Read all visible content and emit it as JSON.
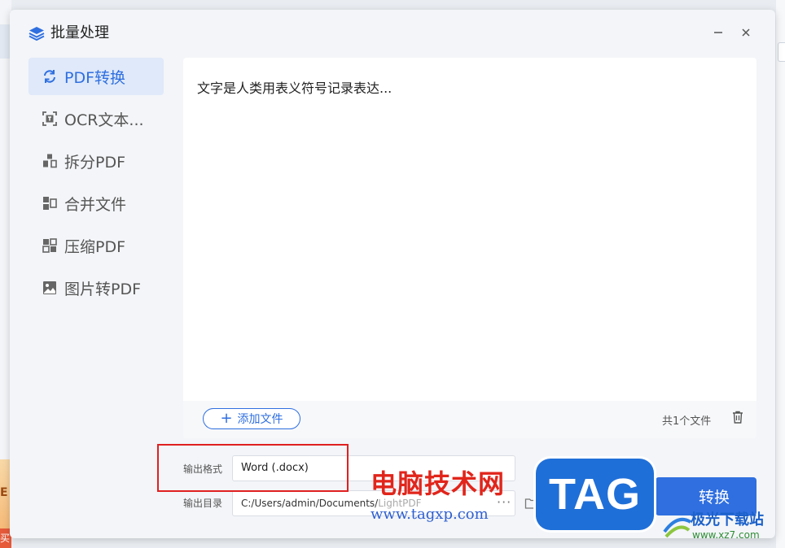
{
  "window": {
    "title": "批量处理",
    "icons": {
      "app": "layers-icon",
      "minimize": "minimize-icon",
      "close": "close-icon"
    }
  },
  "sidebar": {
    "items": [
      {
        "label": "PDF转换",
        "icon": "convert-icon",
        "active": true
      },
      {
        "label": "OCR文本...",
        "icon": "ocr-icon",
        "active": false
      },
      {
        "label": "拆分PDF",
        "icon": "split-icon",
        "active": false
      },
      {
        "label": "合并文件",
        "icon": "merge-icon",
        "active": false
      },
      {
        "label": "压缩PDF",
        "icon": "compress-icon",
        "active": false
      },
      {
        "label": "图片转PDF",
        "icon": "image-icon",
        "active": false
      }
    ]
  },
  "file_list": {
    "items": [
      {
        "name": "文字是人类用表义符号记录表达..."
      }
    ]
  },
  "footer": {
    "add_label": "添加文件",
    "count_text": "共1个文件"
  },
  "output": {
    "format_label": "输出格式",
    "format_value": "Word (.docx)",
    "dir_label": "输出目录",
    "dir_value": "C:/Users/admin/Documents/",
    "dir_value_dim": "LightPDF",
    "dir_more": "···"
  },
  "convert_label": "转换",
  "watermarks": {
    "site_cn": "电脑技术网",
    "site_url": "www.tagxp.com",
    "tag": "TAG",
    "xz_cn": "极光下载站",
    "xz_url": "www.xz7.com"
  },
  "background": {
    "promo_text": "E",
    "promo_badge": "买"
  },
  "colors": {
    "accent": "#2f6fe0",
    "highlight": "#e02020",
    "active_bg": "#dfe9f9"
  }
}
